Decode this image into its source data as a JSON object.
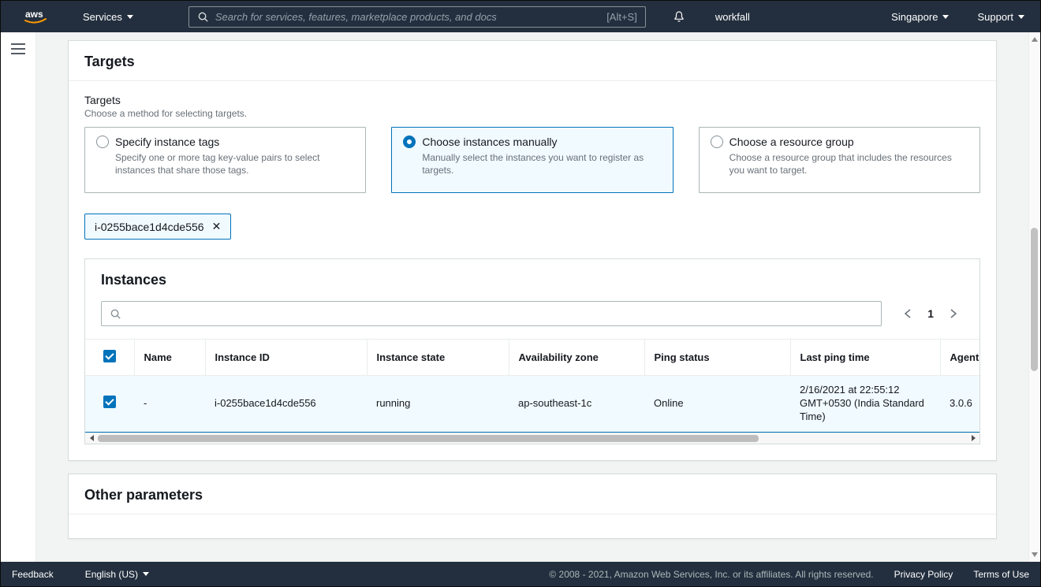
{
  "topnav": {
    "logo": "aws",
    "services_label": "Services",
    "search": {
      "placeholder": "Search for services, features, marketplace products, and docs",
      "shortcut": "[Alt+S]"
    },
    "account_label": "workfall",
    "region_label": "Singapore",
    "support_label": "Support"
  },
  "targets": {
    "card_title": "Targets",
    "field_label": "Targets",
    "field_description": "Choose a method for selecting targets.",
    "options": [
      {
        "title": "Specify instance tags",
        "description": "Specify one or more tag key-value pairs to select instances that share those tags."
      },
      {
        "title": "Choose instances manually",
        "description": "Manually select the instances you want to register as targets."
      },
      {
        "title": "Choose a resource group",
        "description": "Choose a resource group that includes the resources you want to target."
      }
    ],
    "selected_option": "Choose instances manually",
    "token": "i-0255bace1d4cde556",
    "token_remove": "✕"
  },
  "instances": {
    "title": "Instances",
    "search_value": "",
    "pagination": {
      "page": "1"
    },
    "headers": {
      "name": "Name",
      "instance_id": "Instance ID",
      "instance_state": "Instance state",
      "availability_zone": "Availability zone",
      "ping_status": "Ping status",
      "last_ping_time": "Last ping time",
      "agent_version": "Agent version"
    },
    "row": {
      "name": "-",
      "instance_id": "i-0255bace1d4cde556",
      "instance_state": "running",
      "availability_zone": "ap-southeast-1c",
      "ping_status": "Online",
      "last_ping_time": "2/16/2021 at 22:55:12 GMT+0530 (India Standard Time)",
      "agent_version": "3.0.6",
      "selected": true
    }
  },
  "other_parameters": {
    "card_title": "Other parameters"
  },
  "footer": {
    "feedback": "Feedback",
    "language": "English (US)",
    "copyright": "© 2008 - 2021, Amazon Web Services, Inc. or its affiliates. All rights reserved.",
    "privacy": "Privacy Policy",
    "terms": "Terms of Use"
  },
  "colors": {
    "nav_bg": "#232f3e",
    "accent_blue": "#0073bb",
    "selected_bg": "#f1faff",
    "logo_orange": "#ff9900"
  }
}
